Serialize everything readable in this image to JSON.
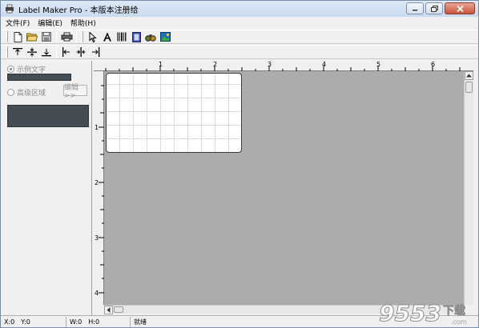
{
  "window": {
    "title": "Label Maker Pro - 本版本注册给",
    "colors": {
      "title_bar": "#c9daee",
      "work_area": "#acacac",
      "dark_box": "#434d53",
      "close_button": "#c7553d"
    }
  },
  "menubar": {
    "items": [
      {
        "label": "文件(F)"
      },
      {
        "label": "编辑(E)"
      },
      {
        "label": "帮助(H)"
      }
    ]
  },
  "toolbar1": {
    "icons": [
      "new-file-icon",
      "open-folder-icon",
      "save-icon",
      "print-icon",
      "select-arrow-icon",
      "text-tool-icon",
      "barcode-tool-icon",
      "document-tool-icon",
      "binoculars-icon",
      "image-tool-icon"
    ]
  },
  "toolbar2": {
    "icons": [
      "align-top-icon",
      "align-middle-icon",
      "align-bottom-icon",
      "align-left-icon",
      "align-center-icon",
      "align-right-icon"
    ]
  },
  "left_panel": {
    "sample_text_label": "示例文字",
    "advanced_area_label": "高级区域",
    "edit_button_label": "编辑>>"
  },
  "rulers": {
    "horizontal_labels": [
      "1",
      "2",
      "3",
      "4",
      "5",
      "6"
    ],
    "vertical_labels": [
      "1",
      "2",
      "3",
      "4"
    ]
  },
  "statusbar": {
    "x": "X:0",
    "y": "Y:0",
    "w": "W:0",
    "h": "H:0",
    "status": "就绪"
  },
  "watermark": {
    "number": "9553",
    "suffix": "下载",
    "site": ".com"
  }
}
